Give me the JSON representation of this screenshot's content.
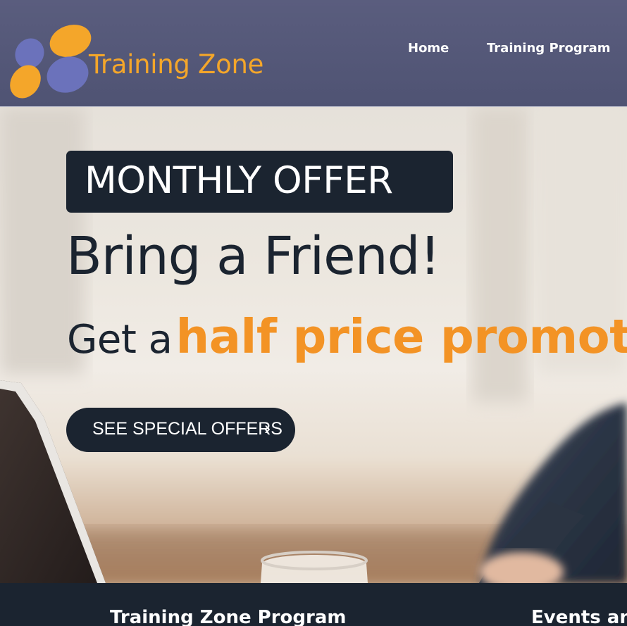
{
  "brand": {
    "name": "Training Zone",
    "colors": {
      "header_bg": "#52567a",
      "accent_orange": "#f4a62a",
      "accent_blue": "#6b72bb",
      "dark": "#1b2430",
      "promo_orange": "#f39325"
    }
  },
  "nav": {
    "items": [
      {
        "label": "Home"
      },
      {
        "label": "Training Program"
      }
    ]
  },
  "hero": {
    "badge": "MONTHLY OFFER",
    "headline": "Bring a Friend!",
    "promo_prefix": "Get a",
    "promo_highlight": "half price promotion",
    "cta": {
      "label": "SEE SPECIAL OFFERS",
      "icon": "chevron-right-icon",
      "glyph": "›"
    },
    "background": "blurred-office-photo"
  },
  "footer": {
    "headings": [
      {
        "label": "Training Zone Program"
      },
      {
        "label": "Events and"
      }
    ]
  }
}
